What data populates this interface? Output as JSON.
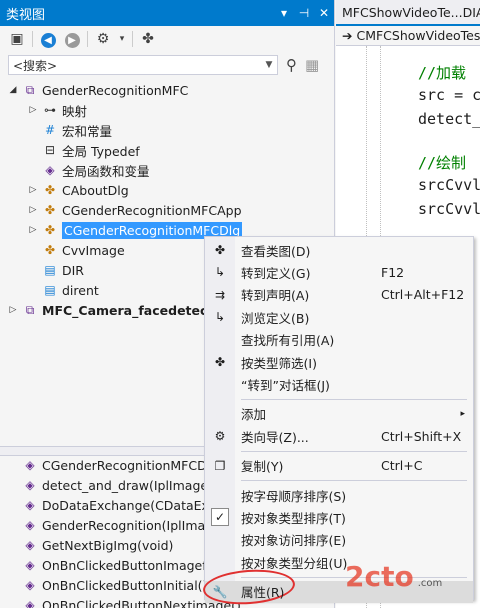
{
  "class_view": {
    "title": "类视图",
    "pin_icon": "▾",
    "pin2_icon": "📌",
    "close_icon": "✕",
    "search_placeholder": "<搜索>",
    "tree": [
      {
        "label": "GenderRecognitionMFC",
        "expand": "◢",
        "icon": "⧉",
        "indent": 0,
        "bold": false
      },
      {
        "label": "映射",
        "expand": "▷",
        "icon": "⊶",
        "indent": 1
      },
      {
        "label": "宏和常量",
        "expand": "",
        "icon": "#",
        "indent": 1
      },
      {
        "label": "全局 Typedef",
        "expand": "",
        "icon": "⊟",
        "indent": 1
      },
      {
        "label": "全局函数和变量",
        "expand": "",
        "icon": "◈",
        "indent": 1
      },
      {
        "label": "CAboutDlg",
        "expand": "▷",
        "icon": "✤",
        "indent": 1
      },
      {
        "label": "CGenderRecognitionMFCApp",
        "expand": "▷",
        "icon": "✤",
        "indent": 1
      },
      {
        "label": "CGenderRecognitionMFCDlg",
        "expand": "▷",
        "icon": "✤",
        "indent": 1,
        "selected": true
      },
      {
        "label": "CvvImage",
        "expand": "",
        "icon": "✤",
        "indent": 1
      },
      {
        "label": "DIR",
        "expand": "",
        "icon": "▤",
        "indent": 1
      },
      {
        "label": "dirent",
        "expand": "",
        "icon": "▤",
        "indent": 1
      },
      {
        "label": "MFC_Camera_facedetection",
        "expand": "▷",
        "icon": "⧉",
        "indent": 0,
        "bold": true
      }
    ],
    "members": [
      "CGenderRecognitionMFCDlg",
      "detect_and_draw(IplImage *",
      "DoDataExchange(CDataExch",
      "GenderRecognition(IplIma",
      "GetNextBigImg(void)",
      "OnBnClickedButtonImagefile",
      "OnBnClickedButtonInitial()",
      "OnBnClickedButtonNextimage()"
    ]
  },
  "editor": {
    "tab_label": "MFCShowVideoTe...DIA",
    "nav_label": "CMFCShowVideoTest",
    "code": [
      {
        "text": "//加载",
        "kind": "comment"
      },
      {
        "text": "src = c",
        "kind": "code"
      },
      {
        "text": "detect_",
        "kind": "code"
      },
      {
        "text": "//绘制",
        "kind": "comment"
      },
      {
        "text": "srcCvvl",
        "kind": "code"
      },
      {
        "text": "srcCvvl",
        "kind": "code"
      }
    ]
  },
  "context_menu": {
    "items": [
      {
        "label": "查看类图(D)",
        "shortcut": "",
        "icon": "✤",
        "type": "item"
      },
      {
        "label": "转到定义(G)",
        "shortcut": "F12",
        "icon": "↳",
        "type": "item"
      },
      {
        "label": "转到声明(A)",
        "shortcut": "Ctrl+Alt+F12",
        "icon": "⇉",
        "type": "item"
      },
      {
        "label": "浏览定义(B)",
        "shortcut": "",
        "icon": "↳",
        "type": "item"
      },
      {
        "label": "查找所有引用(A)",
        "shortcut": "",
        "icon": "",
        "type": "item"
      },
      {
        "label": "按类型筛选(I)",
        "shortcut": "",
        "icon": "✤",
        "type": "item"
      },
      {
        "label": "“转到”对话框(J)",
        "shortcut": "",
        "icon": "",
        "type": "item"
      },
      {
        "type": "separator"
      },
      {
        "label": "添加",
        "shortcut": "",
        "icon": "",
        "type": "submenu"
      },
      {
        "label": "类向导(Z)...",
        "shortcut": "Ctrl+Shift+X",
        "icon": "⚙",
        "type": "item"
      },
      {
        "type": "separator"
      },
      {
        "label": "复制(Y)",
        "shortcut": "Ctrl+C",
        "icon": "❐",
        "type": "item"
      },
      {
        "type": "separator"
      },
      {
        "label": "按字母顺序排序(S)",
        "shortcut": "",
        "icon": "",
        "type": "item"
      },
      {
        "label": "按对象类型排序(T)",
        "shortcut": "",
        "icon": "✓",
        "type": "checked"
      },
      {
        "label": "按对象访问排序(E)",
        "shortcut": "",
        "icon": "",
        "type": "item"
      },
      {
        "label": "按对象类型分组(U)",
        "shortcut": "",
        "icon": "",
        "type": "item"
      },
      {
        "type": "separator"
      },
      {
        "label": "属性(R)",
        "shortcut": "",
        "icon": "🔧",
        "type": "highlighted"
      }
    ],
    "submenu_arrow": "▸"
  },
  "watermark": {
    "text": "2cto",
    "suffix": ".com"
  }
}
